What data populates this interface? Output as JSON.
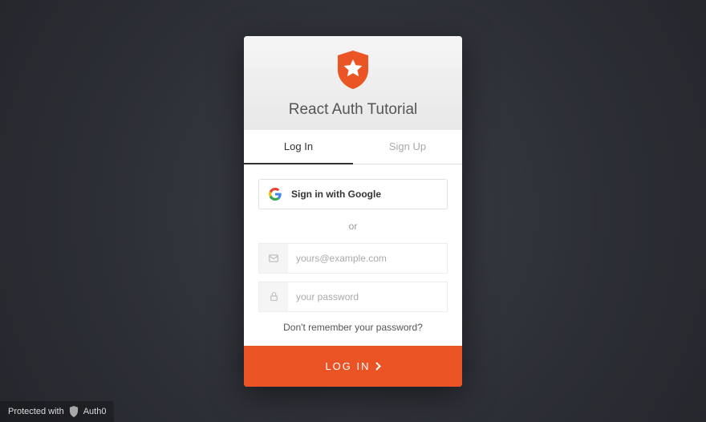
{
  "header": {
    "title": "React Auth Tutorial"
  },
  "tabs": {
    "login": "Log In",
    "signup": "Sign Up"
  },
  "social": {
    "google_label": "Sign in with Google"
  },
  "divider_text": "or",
  "fields": {
    "email_placeholder": "yours@example.com",
    "password_placeholder": "your password"
  },
  "forgot_text": "Don't remember your password?",
  "submit_label": "LOG IN",
  "badge": {
    "prefix": "Protected with",
    "brand": "Auth0"
  },
  "colors": {
    "accent": "#ea5323"
  }
}
